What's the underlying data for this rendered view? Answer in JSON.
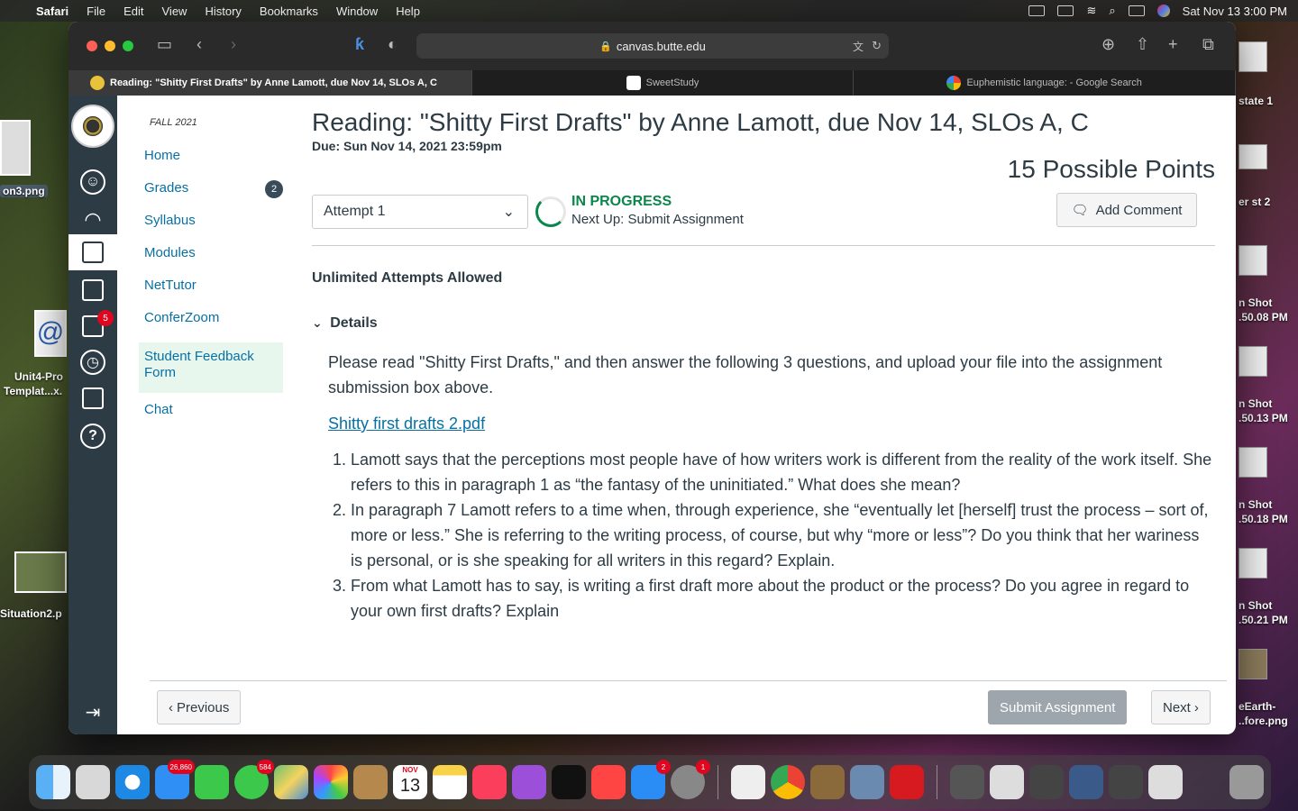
{
  "menubar": {
    "items": [
      "Safari",
      "File",
      "Edit",
      "View",
      "History",
      "Bookmarks",
      "Window",
      "Help"
    ],
    "datetime": "Sat Nov 13  3:00 PM"
  },
  "desktop": {
    "left_labels": [
      "on3.png",
      "Unit4-Pro",
      "Templat...x.",
      "Situation2.p"
    ],
    "right_labels": [
      "state 1",
      "er st 2",
      "n Shot",
      ".50.08 PM",
      "n Shot",
      ".50.13 PM",
      "n Shot",
      ".50.18 PM",
      "n Shot",
      ".50.21 PM",
      "eEarth-",
      "..fore.png"
    ]
  },
  "browser": {
    "url": "canvas.butte.edu",
    "tabs": [
      {
        "label": "Reading: \"Shitty First Drafts\" by Anne Lamott, due Nov 14, SLOs A, C",
        "active": true
      },
      {
        "label": "SweetStudy",
        "active": false
      },
      {
        "label": "Euphemistic language: - Google Search",
        "active": false
      }
    ]
  },
  "globalnav": {
    "inbox_badge": "5"
  },
  "course_nav": {
    "term": "FALL 2021",
    "items": [
      {
        "label": "Home"
      },
      {
        "label": "Grades",
        "badge": "2"
      },
      {
        "label": "Syllabus"
      },
      {
        "label": "Modules"
      },
      {
        "label": "NetTutor"
      },
      {
        "label": "ConferZoom"
      },
      {
        "label": "Student Feedback Form"
      },
      {
        "label": "Chat"
      }
    ]
  },
  "assignment": {
    "title": "Reading: \"Shitty First Drafts\" by Anne Lamott, due Nov 14, SLOs A, C",
    "due": "Due: Sun Nov 14, 2021 23:59pm",
    "points": "15 Possible Points",
    "attempt": "Attempt 1",
    "status": "IN PROGRESS",
    "next_up": "Next Up: Submit Assignment",
    "add_comment": "Add Comment",
    "attempts_allowed": "Unlimited Attempts Allowed",
    "details_label": "Details",
    "intro": "Please read \"Shitty First Drafts,\" and then answer the following 3 questions, and upload your file into the assignment submission box above.",
    "file_link": "Shitty first drafts 2.pdf",
    "questions": [
      "Lamott says that the perceptions  most  people  have  of  how  writers  work  is  different from the reality of the work itself. She refers to this in paragraph 1 as “the fantasy of the uninitiated.” What does she mean?",
      "In  paragraph  7  Lamott  refers  to  a  time  when, through  experience,  she  “eventually  let  [herself]  trust  the  process – sort of,  more  or  less.”  She is  referring  to  the  writing  process,  of  course,  but  why  “more  or  less”? Do you  think  that  her  wariness  is  personal,  or  is  she  speaking  for  all  writers  in  this  regard? Explain.",
      " From what Lamott has to say, is writing a first draft more about the product or the process? Do you agree in regard to your own first drafts? Explain"
    ]
  },
  "footer": {
    "previous": "Previous",
    "submit": "Submit Assignment",
    "next": "Next"
  },
  "dock": {
    "mail_badge": "26,860",
    "messages_badge": "584",
    "calendar_month": "NOV",
    "calendar_day": "13",
    "appstore_badge": "2",
    "settings_badge": "1"
  },
  "colors": {
    "canvas_dark": "#2d3b45",
    "link_blue": "#0770a3",
    "success_green": "#0b874b",
    "badge_red": "#e0061f"
  }
}
